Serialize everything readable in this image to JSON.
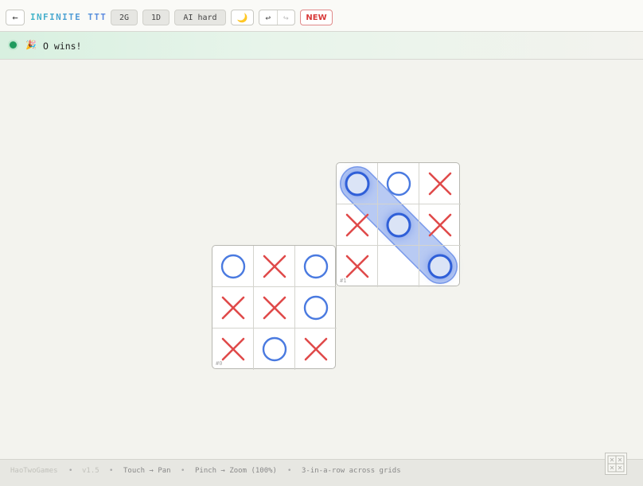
{
  "toolbar": {
    "back_label": "←",
    "title": "INFINITE TTT",
    "grid_mode": "2G",
    "dimension": "1D",
    "ai_level": "AI hard",
    "theme_icon": "moon-icon",
    "theme_glyph": "🌙",
    "undo_label": "↩",
    "redo_label": "↪",
    "new_label": "NEW"
  },
  "status": {
    "icon": "party-icon",
    "icon_glyph": "🎉",
    "text": "O wins!"
  },
  "colors": {
    "x": "#e04a4a",
    "o": "#4a7ae0",
    "win": "#2f5fd8",
    "win_stroke": "#6a8ee8"
  },
  "grids": [
    {
      "label": "#0",
      "cells": [
        "O",
        "X",
        "O",
        "X",
        "X",
        "O",
        "X",
        "O",
        "X"
      ],
      "winning": []
    },
    {
      "label": "#1",
      "cells": [
        "O",
        "O",
        "X",
        "X",
        "O",
        "X",
        "X",
        "",
        "O"
      ],
      "winning": [
        0,
        4,
        8
      ]
    }
  ],
  "footer": {
    "brand": "HaoTwoGames",
    "sep": "•",
    "version": "v1.5",
    "pan": "Touch → Pan",
    "zoom": "Pinch → Zoom (100%)",
    "rule": "3-in-a-row across grids"
  }
}
